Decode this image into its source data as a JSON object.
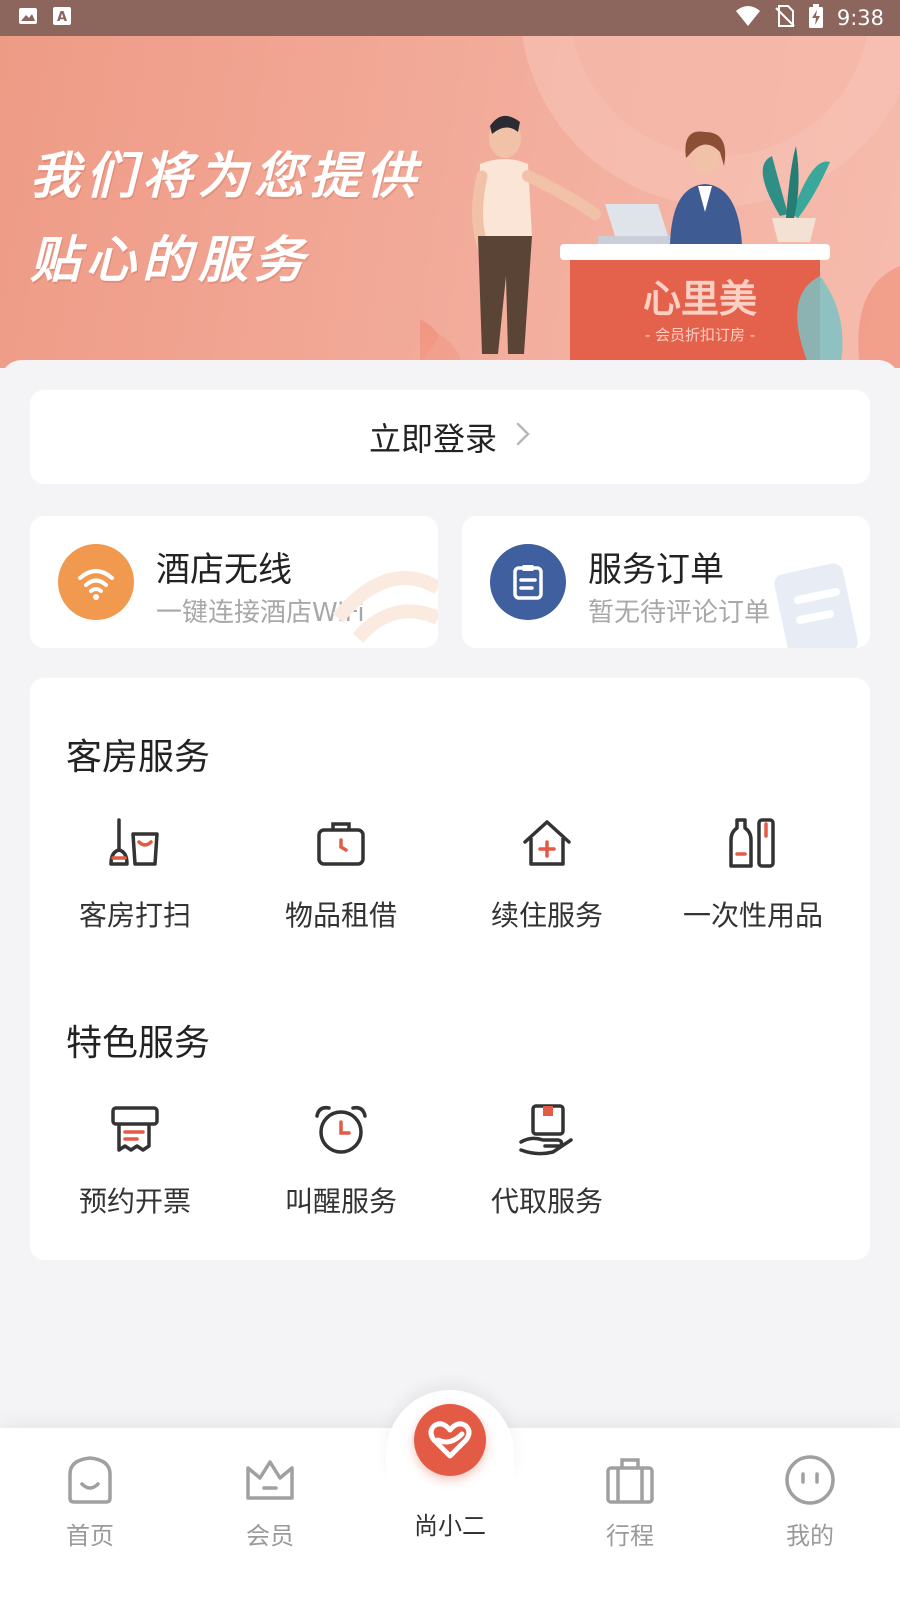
{
  "status_bar": {
    "time": "9:38",
    "left_icons": [
      "gallery-icon",
      "keyboard-a-icon"
    ],
    "right_icons": [
      "wifi-icon",
      "no-sim-icon",
      "battery-charging-icon"
    ]
  },
  "banner": {
    "line1": "我们将为您提供",
    "line2": "贴心的服务",
    "desk_brand": "心里美",
    "desk_slogan": "- 会员折扣订房 -"
  },
  "login": {
    "label": "立即登录"
  },
  "quick_cards": [
    {
      "title": "酒店无线",
      "subtitle": "一键连接酒店WiFi",
      "icon": "wifi-icon",
      "color": "#f0994f"
    },
    {
      "title": "服务订单",
      "subtitle": "暂无待评论订单",
      "icon": "clipboard-icon",
      "color": "#3f5f9e"
    }
  ],
  "room_services": {
    "title": "客房服务",
    "items": [
      {
        "label": "客房打扫",
        "icon": "cleaning-icon"
      },
      {
        "label": "物品租借",
        "icon": "suitcase-icon"
      },
      {
        "label": "续住服务",
        "icon": "house-plus-icon"
      },
      {
        "label": "一次性用品",
        "icon": "toiletries-icon"
      }
    ]
  },
  "special_services": {
    "title": "特色服务",
    "items": [
      {
        "label": "预约开票",
        "icon": "receipt-printer-icon"
      },
      {
        "label": "叫醒服务",
        "icon": "alarm-clock-icon"
      },
      {
        "label": "代取服务",
        "icon": "hand-package-icon"
      }
    ]
  },
  "bottom_nav": {
    "items": [
      {
        "label": "首页",
        "icon": "home-icon"
      },
      {
        "label": "会员",
        "icon": "crown-icon"
      },
      {
        "label": "尚小二",
        "icon": "heart-badge-icon",
        "active": true
      },
      {
        "label": "行程",
        "icon": "luggage-icon"
      },
      {
        "label": "我的",
        "icon": "smiley-icon"
      }
    ]
  },
  "colors": {
    "accent": "#e35a45",
    "banner": "#f2a997",
    "background": "#f4f4f6"
  }
}
